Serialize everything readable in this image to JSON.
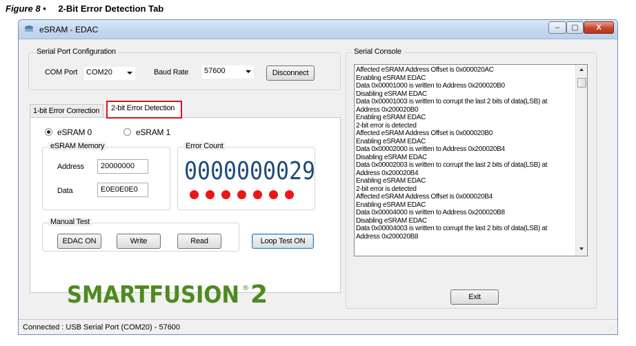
{
  "caption": {
    "figure": "Figure 8 •",
    "title": "2-Bit Error Detection Tab"
  },
  "window": {
    "title": "eSRAM - EDAC",
    "controls": [
      "–",
      "▢",
      "X"
    ]
  },
  "serial_port": {
    "group_title": "Serial Port Configuration",
    "com_port_label": "COM Port",
    "com_port_value": "COM20",
    "baud_rate_label": "Baud Rate",
    "baud_rate_value": "57600",
    "disconnect_label": "Disconnect"
  },
  "tabs": [
    {
      "label": "1-bit Error Correction",
      "selected": false
    },
    {
      "label": "2-bit Error Detection",
      "selected": true
    }
  ],
  "radio": {
    "esram0": "eSRAM 0",
    "esram1": "eSRAM 1",
    "selected": "eSRAM 0"
  },
  "memory": {
    "group_title": "eSRAM Memory",
    "address_label": "Address",
    "address_value": "20000000",
    "data_label": "Data",
    "data_value": "E0E0E0E0"
  },
  "error_count": {
    "group_title": "Error Count",
    "value": "0000000029",
    "leds_on": 7
  },
  "manual_test": {
    "group_title": "Manual Test",
    "edac_label": "EDAC ON",
    "write_label": "Write",
    "read_label": "Read"
  },
  "loop_test_label": "Loop Test ON",
  "console": {
    "group_title": "Serial Console",
    "lines": [
      "Affected eSRAM Address Offset is 0x000020AC",
      "Enabling eSRAM EDAC",
      "Data 0x00001000 is written to Address 0x200020B0",
      "Disabling eSRAM EDAC",
      "Data 0x00001003 is written to corrupt the last 2 bits of data(LSB) at",
      "Address 0x200020B0",
      "Enabling eSRAM EDAC",
      "2-bit error is detected",
      "Affected eSRAM Address Offset is 0x000020B0",
      "Enabling eSRAM EDAC",
      "Data 0x00002000 is written to Address 0x200020B4",
      "Disabling eSRAM EDAC",
      "Data 0x00002003 is written to corrupt the last 2 bits of data(LSB) at",
      "Address 0x200020B4",
      "Enabling eSRAM EDAC",
      "2-bit error is detected",
      "Affected eSRAM Address Offset is 0x000020B4",
      "Enabling eSRAM EDAC",
      "Data 0x00004000 is written to Address 0x200020B8",
      "Disabling eSRAM EDAC",
      "Data 0x00004003 is written to corrupt the last 2 bits of data(LSB) at",
      "Address 0x200020B8"
    ]
  },
  "logo": {
    "text": "SMARTFUSION",
    "suffix": "2",
    "registered": "®"
  },
  "exit_label": "Exit",
  "status": "Connected : USB Serial Port (COM20) - 57600",
  "colors": {
    "lcd": "#1e4a7a",
    "led": "#ee1515",
    "logo_green": "#4f8a1e",
    "tab_highlight": "#d9141a"
  }
}
